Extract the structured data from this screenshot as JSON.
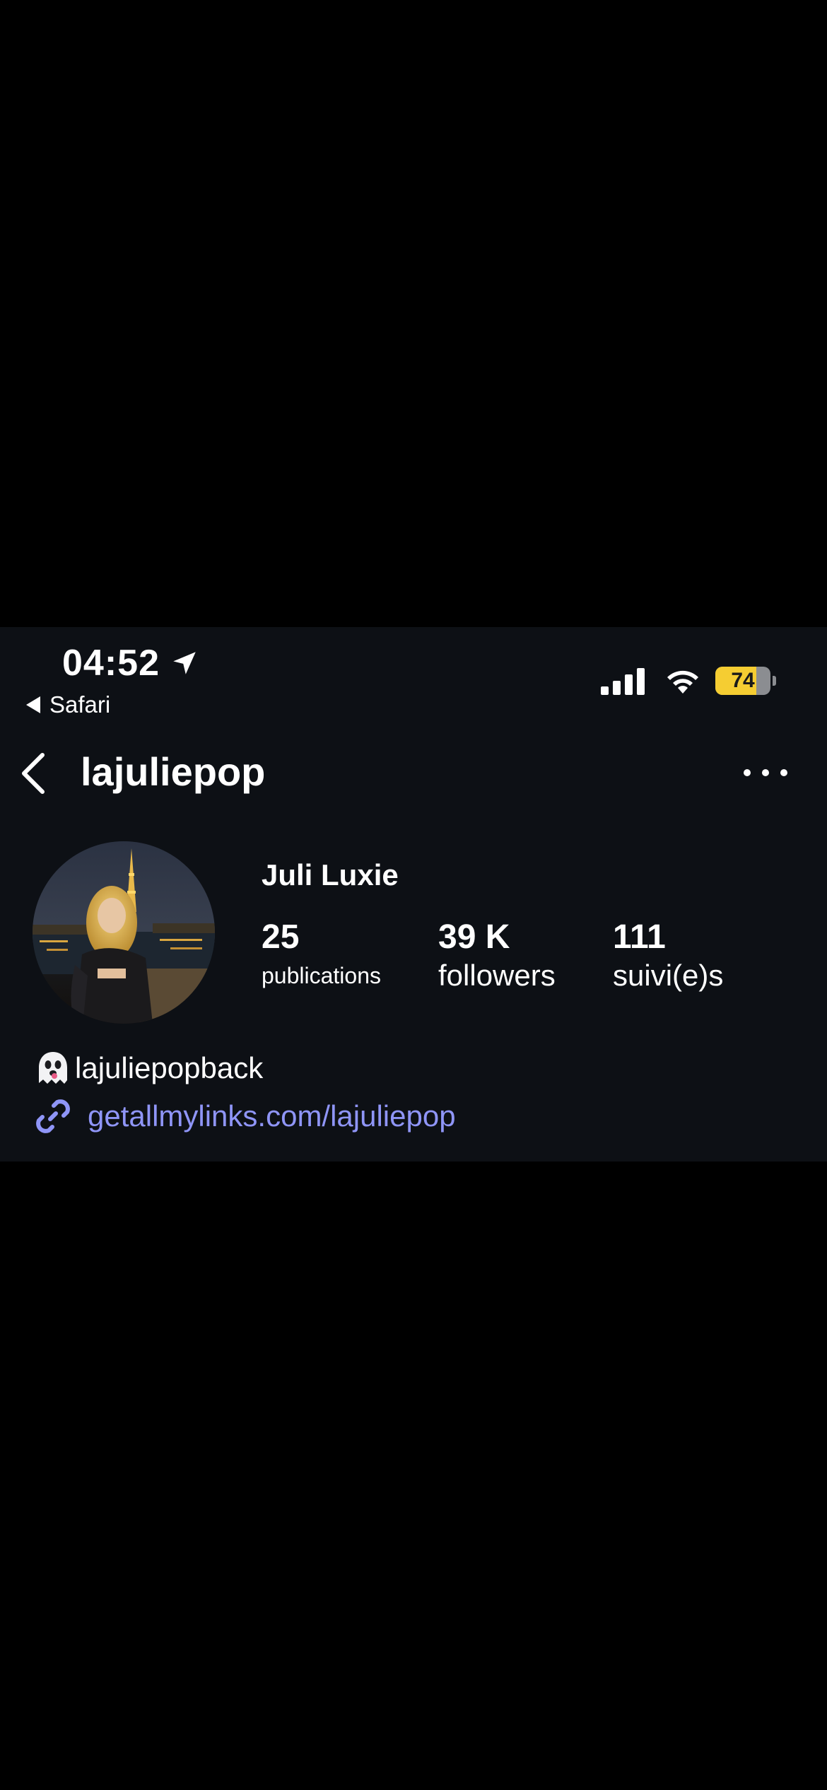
{
  "status_bar": {
    "time": "04:52",
    "back_app": "Safari",
    "battery_level": "74",
    "battery_fraction": 0.74,
    "location_icon": "location-arrow-icon",
    "signal_icon": "cellular-signal-icon",
    "wifi_icon": "wifi-icon"
  },
  "nav": {
    "back_icon": "chevron-left-icon",
    "title": "lajuliepop",
    "more_icon": "more-horizontal-icon"
  },
  "profile": {
    "display_name": "Juli Luxie",
    "stats": [
      {
        "value": "25",
        "label": "publications"
      },
      {
        "value": "39 K",
        "label": "followers"
      },
      {
        "value": "111",
        "label": "suivi(e)s"
      }
    ],
    "bio": {
      "snapchat_emoji_icon": "ghost-icon",
      "snapchat_handle": "lajuliepopback"
    },
    "link": {
      "icon": "link-icon",
      "text": "getallmylinks.com/lajuliepop"
    }
  },
  "colors": {
    "panel_background": "#0d1015",
    "page_background": "#000000",
    "link_color": "#8f95f7",
    "battery_fill": "#f5cd32"
  }
}
